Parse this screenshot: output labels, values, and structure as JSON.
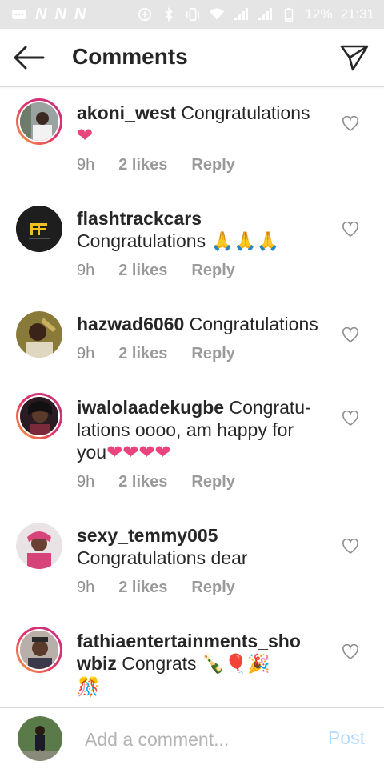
{
  "status_bar": {
    "battery": "12%",
    "time": "21:31",
    "left_glyphs": [
      "N",
      "N",
      "N"
    ]
  },
  "header": {
    "title": "Comments"
  },
  "comments": [
    {
      "username": "akoni_west",
      "text": "Congratulations",
      "emoji": "❤",
      "time": "9h",
      "likes": "2 likes",
      "reply": "Reply"
    },
    {
      "username": "flashtrackcars",
      "text": "Congratulations",
      "emoji": "🙏🙏🙏",
      "time": "9h",
      "likes": "2 likes",
      "reply": "Reply"
    },
    {
      "username": "hazwad6060",
      "text": "Congratulations",
      "time": "9h",
      "likes": "2 likes",
      "reply": "Reply"
    },
    {
      "username": "iwalolaadekugbe",
      "text_line1": "Congratu-",
      "text_line2": "lations oooo, am happy for",
      "text_line3": "you",
      "emoji": "❤❤❤❤",
      "time": "9h",
      "likes": "2 likes",
      "reply": "Reply"
    },
    {
      "username": "sexy_temmy005",
      "text": "Congratulations dear",
      "time": "9h",
      "likes": "2 likes",
      "reply": "Reply"
    },
    {
      "username_line1": "fathiaentertainments_sho",
      "username_line2": "wbiz",
      "text": "Congrats",
      "emoji": "🍾🎈🎉",
      "emoji2": "🎊"
    }
  ],
  "input": {
    "placeholder": "Add a comment...",
    "post_label": "Post"
  },
  "colors": {
    "accent_post": "#b3dbff",
    "heart": "#e8457c",
    "meta_gray": "#8e8e8e"
  }
}
